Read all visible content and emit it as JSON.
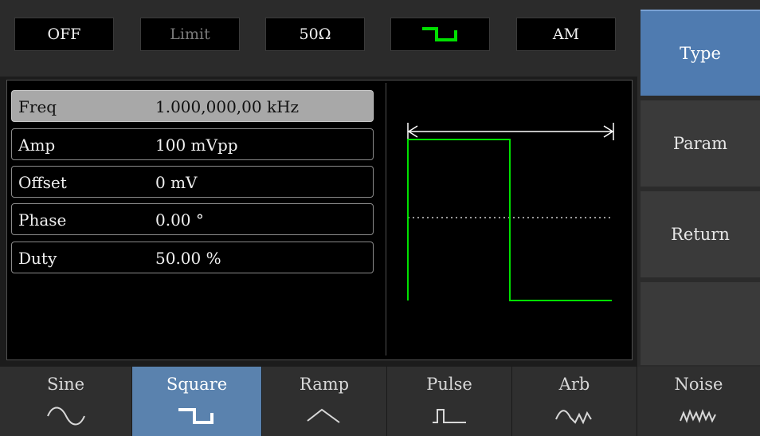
{
  "status": {
    "output": "OFF",
    "limit": "Limit",
    "impedance": "50Ω",
    "waveform_icon": "square-wave-icon",
    "mode": "AM"
  },
  "params": [
    {
      "name": "Freq",
      "value": "1.000,000,00 kHz",
      "selected": true
    },
    {
      "name": "Amp",
      "value": "100 mVpp"
    },
    {
      "name": "Offset",
      "value": "0 mV"
    },
    {
      "name": "Phase",
      "value": "0.00 °"
    },
    {
      "name": "Duty",
      "value": "50.00 %"
    }
  ],
  "preview": {
    "duty_percent": 50,
    "trace_color": "#00e000"
  },
  "softkeys": [
    {
      "label": "Type",
      "active": true
    },
    {
      "label": "Param"
    },
    {
      "label": "Return"
    },
    {
      "label": ""
    }
  ],
  "functions": [
    {
      "label": "Sine",
      "icon": "sine-wave-icon"
    },
    {
      "label": "Square",
      "icon": "square-wave-icon",
      "active": true
    },
    {
      "label": "Ramp",
      "icon": "ramp-wave-icon"
    },
    {
      "label": "Pulse",
      "icon": "pulse-wave-icon"
    },
    {
      "label": "Arb",
      "icon": "arb-wave-icon"
    },
    {
      "label": "Noise",
      "icon": "noise-wave-icon"
    }
  ],
  "colors": {
    "accent": "#4f7bb0",
    "trace": "#00e000",
    "panel": "#000000"
  }
}
